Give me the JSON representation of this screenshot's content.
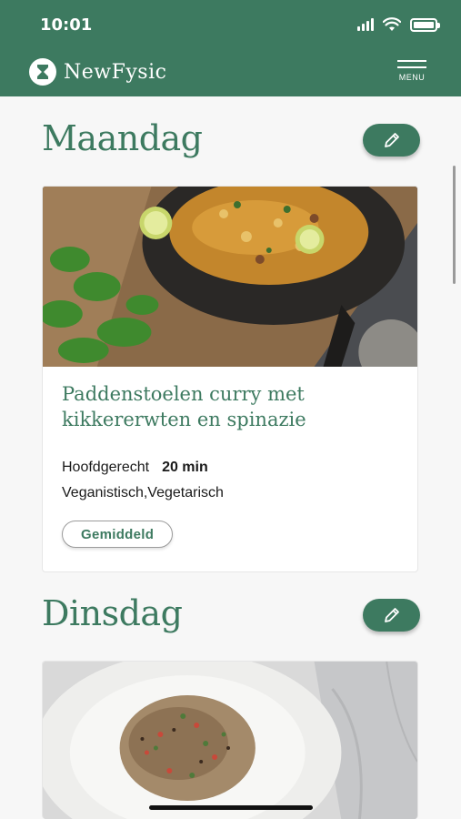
{
  "status": {
    "time": "10:01"
  },
  "header": {
    "brand": "NewFysic",
    "menu_label": "MENU"
  },
  "days": [
    {
      "day": "Maandag",
      "recipe": {
        "title": "Paddenstoelen curry met kikkererwten en spinazie",
        "course": "Hoofdgerecht",
        "time": "20 min",
        "tags": "Veganistisch,Vegetarisch",
        "difficulty": "Gemiddeld"
      }
    },
    {
      "day": "Dinsdag"
    }
  ],
  "colors": {
    "brand_green": "#3d7a60"
  },
  "icons": [
    "pencil-icon",
    "menu-icon",
    "wifi-icon",
    "battery-icon",
    "signal-icon"
  ]
}
